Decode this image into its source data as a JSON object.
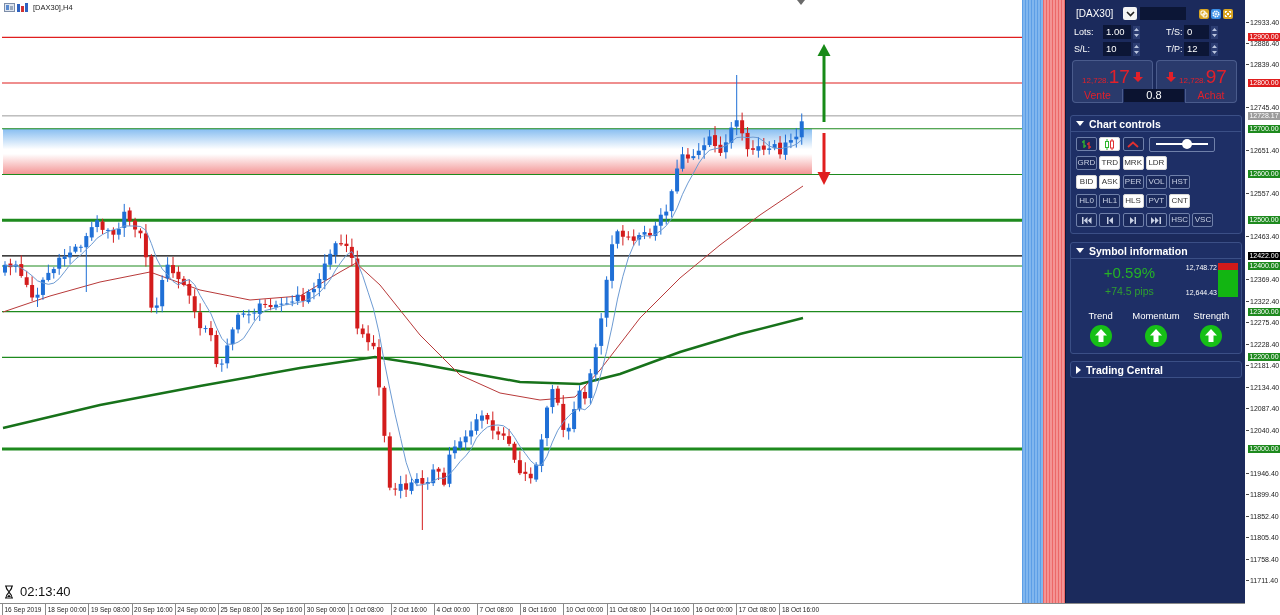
{
  "chart": {
    "title": "[DAX30],H4",
    "timer": "02:13:40",
    "levels": [
      {
        "label": "12900.00",
        "color": "#e01e1e",
        "kind": "level"
      },
      {
        "label": "12800.00",
        "color": "#e01e1e",
        "kind": "level"
      },
      {
        "label": "12728.17",
        "color": "#9c9c9c",
        "kind": "current"
      },
      {
        "label": "12700.00",
        "color": "#1e8a1e",
        "kind": "level"
      },
      {
        "label": "12600.00",
        "color": "#1e8a1e",
        "kind": "level"
      },
      {
        "label": "12500.00",
        "color": "#1e8a1e",
        "kind": "major"
      },
      {
        "label": "12422.00",
        "color": "#000000",
        "kind": "level"
      },
      {
        "label": "12400.00",
        "color": "#1e8a1e",
        "kind": "level"
      },
      {
        "label": "12300.00",
        "color": "#1e8a1e",
        "kind": "level"
      },
      {
        "label": "12200.00",
        "color": "#1e8a1e",
        "kind": "level"
      },
      {
        "label": "12000.00",
        "color": "#1e8a1e",
        "kind": "major"
      }
    ],
    "price_ticks": [
      "12933.40",
      "12886.40",
      "12839.40",
      "12745.40",
      "12651.40",
      "12557.40",
      "12463.40",
      "12369.40",
      "12322.40",
      "12275.40",
      "12228.40",
      "12181.40",
      "12134.40",
      "12087.40",
      "12040.40",
      "11946.40",
      "11899.40",
      "11852.40",
      "11805.40",
      "11758.40",
      "11711.40"
    ],
    "time_labels": [
      "16 Sep 2019",
      "18 Sep 00:00",
      "19 Sep 08:00",
      "20 Sep 16:00",
      "24 Sep 00:00",
      "25 Sep 08:00",
      "26 Sep 16:00",
      "30 Sep 00:00",
      "1 Oct 08:00",
      "2 Oct 16:00",
      "4 Oct 00:00",
      "7 Oct 08:00",
      "8 Oct 16:00",
      "10 Oct 00:00",
      "11 Oct 08:00",
      "14 Oct 16:00",
      "16 Oct 00:00",
      "17 Oct 08:00",
      "18 Oct 16:00"
    ]
  },
  "panel": {
    "symbol": "[DAX30]",
    "order_fields": [
      {
        "label": "Lots:",
        "value": "1.00"
      },
      {
        "label": "T/S:",
        "value": "0"
      },
      {
        "label": "S/L:",
        "value": "10"
      },
      {
        "label": "T/P:",
        "value": "12"
      }
    ],
    "sell": {
      "price_base": "12,728.",
      "price_pips": "17",
      "label": "Vente"
    },
    "buy": {
      "price_base": "12,728.",
      "price_pips": "97",
      "label": "Achat"
    },
    "spread": "0.8",
    "chart_controls": {
      "title": "Chart controls",
      "expanded": true,
      "chart_types": [
        {
          "kind": "bars",
          "selected": false
        },
        {
          "kind": "candles",
          "selected": true
        },
        {
          "kind": "line",
          "selected": false
        }
      ],
      "zoom": {
        "level": 0.6
      },
      "toggle_rows": [
        [
          {
            "label": "GRD",
            "selected": false
          },
          {
            "label": "TRD",
            "selected": true
          },
          {
            "label": "MRK",
            "selected": true
          },
          {
            "label": "LDR",
            "selected": true
          }
        ],
        [
          {
            "label": "BID",
            "selected": true
          },
          {
            "label": "ASK",
            "selected": true
          },
          {
            "label": "PER",
            "selected": false
          },
          {
            "label": "VOL",
            "selected": false
          },
          {
            "label": "HST",
            "selected": false
          }
        ],
        [
          {
            "label": "HL0",
            "selected": false
          },
          {
            "label": "HL1",
            "selected": false
          },
          {
            "label": "HLS",
            "selected": true
          },
          {
            "label": "PVT",
            "selected": false
          },
          {
            "label": "CNT",
            "selected": true
          }
        ]
      ],
      "navigation": [
        {
          "kind": "first"
        },
        {
          "kind": "previous"
        },
        {
          "kind": "next"
        },
        {
          "kind": "last"
        }
      ],
      "scale_buttons": [
        {
          "label": "HSC",
          "selected": false
        },
        {
          "label": "VSC",
          "selected": false
        }
      ]
    },
    "symbol_information": {
      "title": "Symbol information",
      "expanded": true,
      "change": "+0.59%",
      "pips": "+74.5 pips",
      "high": "12,748.72",
      "low": "12,644.43",
      "range": {
        "level": 0.8
      },
      "indicators": [
        {
          "label": "Trend",
          "rising": true
        },
        {
          "label": "Momentum",
          "rising": true
        },
        {
          "label": "Strength",
          "rising": true
        }
      ]
    },
    "trading_central": {
      "title": "Trading Central",
      "expanded": false
    }
  }
}
